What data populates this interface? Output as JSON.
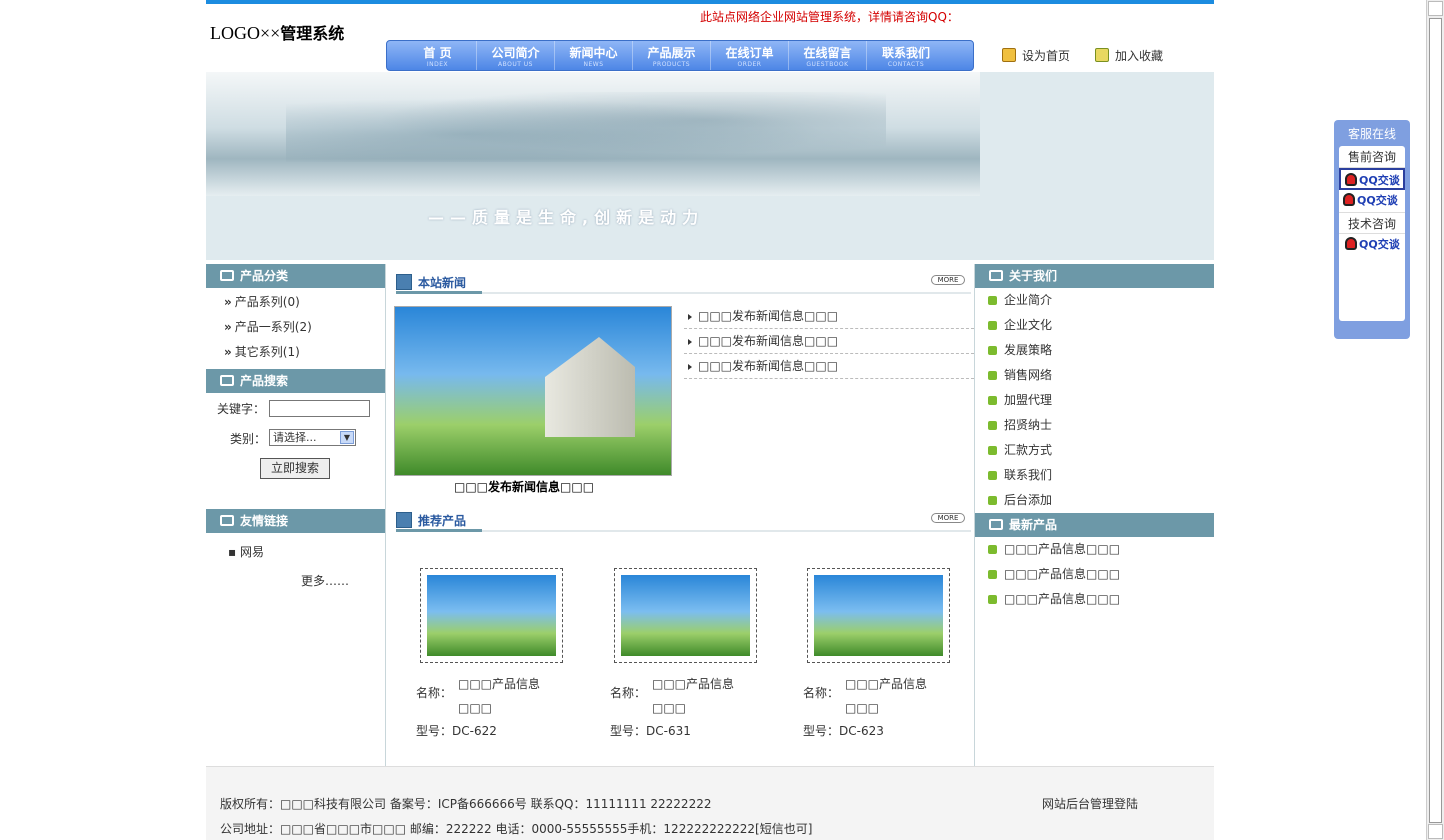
{
  "header": {
    "logo_prefix": "LOGO××",
    "logo_bold": "管理系统",
    "notice": "此站点网络企业网站管理系统，详情请咨询QQ：",
    "set_home": "设为首页",
    "add_favorite": "加入收藏"
  },
  "nav": [
    {
      "label": "首 页",
      "en": "INDEX"
    },
    {
      "label": "公司简介",
      "en": "ABOUT US"
    },
    {
      "label": "新闻中心",
      "en": "NEWS"
    },
    {
      "label": "产品展示",
      "en": "PRODUCTS"
    },
    {
      "label": "在线订单",
      "en": "ORDER"
    },
    {
      "label": "在线留言",
      "en": "GUESTBOOK"
    },
    {
      "label": "联系我们",
      "en": "CONTACTS"
    }
  ],
  "banner": {
    "slogan": "——质量是生命,创新是动力"
  },
  "left": {
    "category_title": "产品分类",
    "categories": [
      "产品系列(0)",
      "产品一系列(2)",
      "其它系列(1)"
    ],
    "search_title": "产品搜索",
    "keyword_label": "关键字：",
    "keyword_value": "",
    "type_label": "类别：",
    "type_selected": "请选择...",
    "search_button": "立即搜索",
    "links_title": "友情链接",
    "links": [
      "网易"
    ],
    "more_links": "更多……"
  },
  "middle": {
    "news_title": "本站新闻",
    "more": "MORE",
    "news": [
      "□□□发布新闻信息□□□",
      "□□□发布新闻信息□□□",
      "□□□发布新闻信息□□□"
    ],
    "news_caption": "□□□发布新闻信息□□□",
    "products_title": "推荐产品",
    "name_label": "名称：",
    "model_label": "型号：",
    "products": [
      {
        "name": "□□□产品信息□□□",
        "model": "DC-622"
      },
      {
        "name": "□□□产品信息□□□",
        "model": "DC-631"
      },
      {
        "name": "□□□产品信息□□□",
        "model": "DC-623"
      }
    ]
  },
  "right": {
    "about_title": "关于我们",
    "about": [
      "企业简介",
      "企业文化",
      "发展策略",
      "销售网络",
      "加盟代理",
      "招贤纳士",
      "汇款方式",
      "联系我们",
      "后台添加"
    ],
    "latest_title": "最新产品",
    "latest": [
      "□□□产品信息□□□",
      "□□□产品信息□□□",
      "□□□产品信息□□□"
    ]
  },
  "footer": {
    "line1": "版权所有：□□□科技有限公司 备案号：ICP备666666号 联系QQ：11111111  22222222",
    "line2": "公司地址：□□□省□□□市□□□ 邮编：222222 电话：0000-55555555手机：122222222222[短信也可]",
    "admin_login": "网站后台管理登陆"
  },
  "service": {
    "title": "客服在线",
    "presale": "售前咨询",
    "tech": "技术咨询",
    "qq_label": "QQ交谈"
  },
  "colors": {
    "accent": "#1c8ce0",
    "side_header": "#6c98a8",
    "notice": "#d40000"
  }
}
